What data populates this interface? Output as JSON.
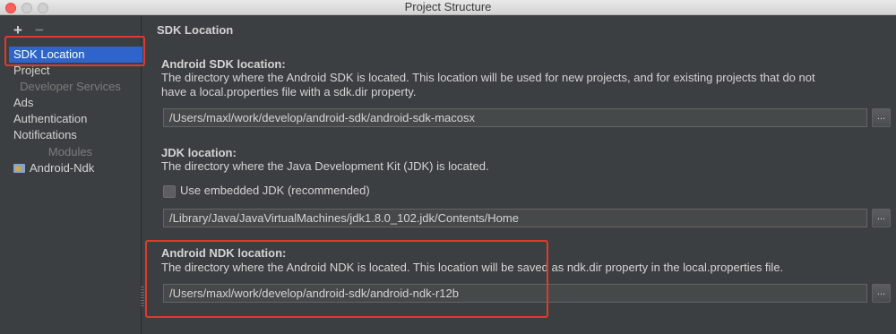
{
  "window": {
    "title": "Project Structure"
  },
  "sidebar": {
    "add_symbol": "+",
    "remove_symbol": "−",
    "items": [
      {
        "label": "SDK Location"
      },
      {
        "label": "Project"
      },
      {
        "label": "Ads"
      },
      {
        "label": "Authentication"
      },
      {
        "label": "Notifications"
      },
      {
        "label": "Android-Ndk"
      }
    ],
    "headers": [
      "Developer Services",
      "Modules"
    ]
  },
  "main": {
    "page_title": "SDK Location",
    "sdk": {
      "title": "Android SDK location:",
      "desc_line1": "The directory where the Android SDK is located. This location will be used for new projects, and for existing projects that do not",
      "desc_line2": "have a local.properties file with a sdk.dir property.",
      "value": "/Users/maxl/work/develop/android-sdk/android-sdk-macosx"
    },
    "jdk": {
      "title": "JDK location:",
      "desc": "The directory where the Java Development Kit (JDK) is located.",
      "checkbox_label": "Use embedded JDK (recommended)",
      "checkbox_checked": false,
      "value": "/Library/Java/JavaVirtualMachines/jdk1.8.0_102.jdk/Contents/Home"
    },
    "ndk": {
      "title": "Android NDK location:",
      "desc": "The directory where the Android NDK is located. This location will be saved as ndk.dir property in the local.properties file.",
      "value": "/Users/maxl/work/develop/android-sdk/android-ndk-r12b"
    },
    "browse_label": "..."
  },
  "colors": {
    "background": "#3c3f41",
    "selection": "#2f65ca",
    "highlight_box": "#e03a2f"
  }
}
